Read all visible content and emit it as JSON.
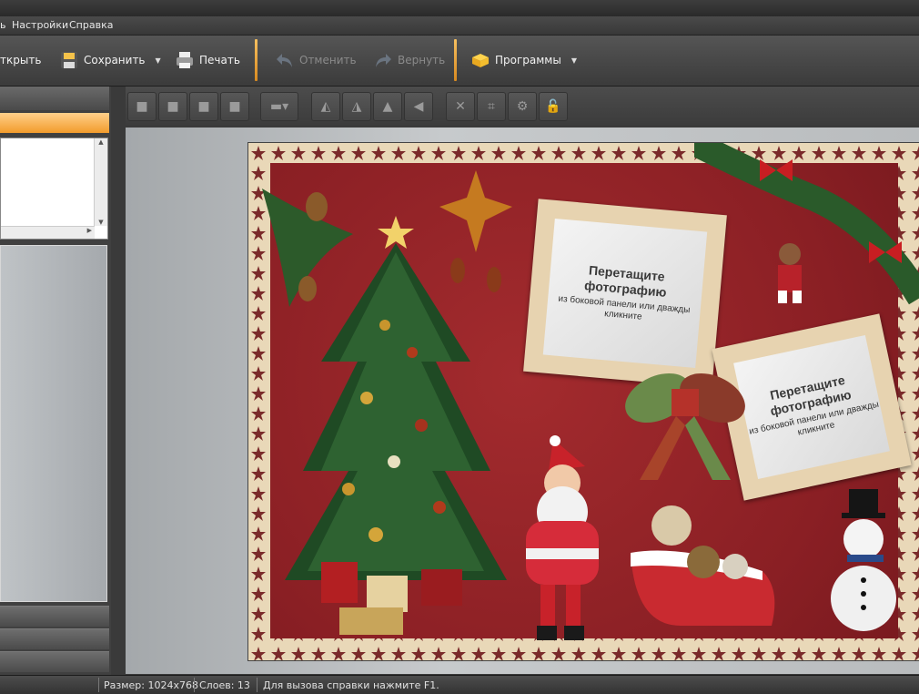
{
  "menu": {
    "items": [
      "ь",
      "Настройки",
      "Справка"
    ]
  },
  "toolbar": {
    "open_label": "ткрыть",
    "save_label": "Сохранить",
    "print_label": "Печать",
    "undo_label": "Отменить",
    "redo_label": "Вернуть",
    "programs_label": "Программы"
  },
  "icons": {
    "open": "folder-icon",
    "save": "floppy-icon",
    "print": "printer-icon",
    "undo": "undo-icon",
    "redo": "redo-icon",
    "programs": "box-icon"
  },
  "colors": {
    "accent": "#f29b2c",
    "card_bg": "#8a1f24",
    "frame": "#e7d3b0"
  },
  "canvas": {
    "photo_slots": [
      {
        "title": "Перетащите фотографию",
        "sub": "из боковой панели или дважды кликните"
      },
      {
        "title": "Перетащите фотографию",
        "sub": "из боковой панели или дважды кликните"
      }
    ]
  },
  "status": {
    "size": "Размер: 1024x768",
    "layers": "Слоев: 13",
    "hint": "Для вызова справки нажмите F1."
  }
}
